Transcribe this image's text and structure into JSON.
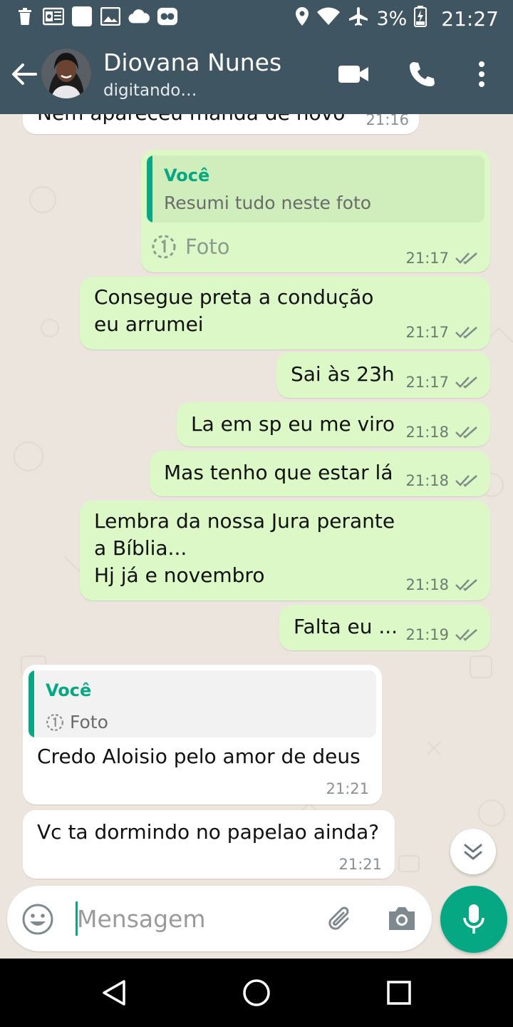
{
  "status_bar": {
    "battery": "3%",
    "time": "21:27",
    "icons_left": [
      "trash-icon",
      "outlook-icon",
      "blank-app-icon",
      "gallery-icon",
      "cloud-icon",
      "game-icon"
    ],
    "icons_right": [
      "location-icon",
      "wifi-icon",
      "airplane-icon",
      "battery-charging-icon"
    ]
  },
  "header": {
    "contact_name": "Diovana Nunes",
    "contact_status": "digitando…",
    "colors": {
      "bar": "#3f5562"
    }
  },
  "messages": [
    {
      "id": "m0",
      "direction": "in",
      "text": "Nem apareceu manda de novo",
      "time": "21:16"
    },
    {
      "id": "m1",
      "direction": "out",
      "quote_author": "Você",
      "quote_text": "Resumi tudo neste foto",
      "text": "Foto",
      "time": "21:17",
      "ticks": "double"
    },
    {
      "id": "m2",
      "direction": "out",
      "lines": [
        "Consegue preta a condução",
        "eu arrumei"
      ],
      "time": "21:17",
      "ticks": "double"
    },
    {
      "id": "m3",
      "direction": "out",
      "text": "Sai às 23h",
      "time": "21:17",
      "ticks": "double"
    },
    {
      "id": "m4",
      "direction": "out",
      "text": "La em sp eu me viro",
      "time": "21:18",
      "ticks": "double"
    },
    {
      "id": "m5",
      "direction": "out",
      "text": "Mas tenho que estar lá",
      "time": "21:18",
      "ticks": "double"
    },
    {
      "id": "m6",
      "direction": "out",
      "lines": [
        "Lembra da nossa Jura perante",
        "a Bíblia...",
        "Hj já e novembro"
      ],
      "time": "21:18",
      "ticks": "double"
    },
    {
      "id": "m7",
      "direction": "out",
      "text": "Falta eu ...",
      "time": "21:19",
      "ticks": "double"
    },
    {
      "id": "m8",
      "direction": "in",
      "quote_author": "Você",
      "quote_text": "Foto",
      "text": "Credo Aloisio pelo amor de deus",
      "time": "21:21"
    },
    {
      "id": "m9",
      "direction": "in",
      "text": "Vc ta dormindo no papelao ainda?",
      "time": "21:21"
    }
  ],
  "composer": {
    "placeholder": "Mensagem",
    "value": ""
  },
  "colors": {
    "accent": "#06a884",
    "outgoing_bubble": "#dcf8c6",
    "incoming_bubble": "#ffffff",
    "chat_background": "#ece5dd"
  }
}
